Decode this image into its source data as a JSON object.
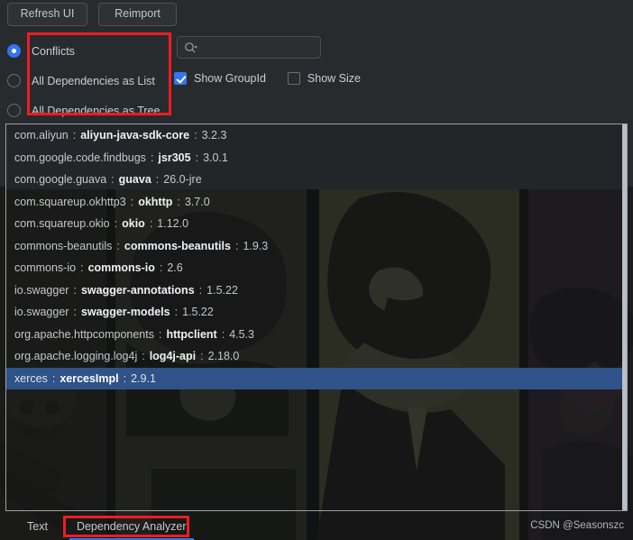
{
  "window": {
    "background_color": "#282b2e",
    "accent_color": "#3574f0",
    "annotation_color": "#ee1c25",
    "selection_color": "#2f5288"
  },
  "toolbar": {
    "refresh_label": "Refresh UI",
    "reimport_label": "Reimport"
  },
  "view_mode": {
    "options": [
      {
        "label": "Conflicts",
        "selected": true
      },
      {
        "label": "All Dependencies as List",
        "selected": false
      },
      {
        "label": "All Dependencies as Tree",
        "selected": false
      }
    ]
  },
  "search": {
    "icon": "search-icon",
    "value": "",
    "placeholder": ""
  },
  "options": {
    "show_groupid": {
      "label": "Show GroupId",
      "checked": true
    },
    "show_size": {
      "label": "Show Size",
      "checked": false
    }
  },
  "dependency_list": {
    "rows": [
      {
        "group": "com.aliyun",
        "artifact": "aliyun-java-sdk-core",
        "version": "3.2.3",
        "selected": false
      },
      {
        "group": "com.google.code.findbugs",
        "artifact": "jsr305",
        "version": "3.0.1",
        "selected": false
      },
      {
        "group": "com.google.guava",
        "artifact": "guava",
        "version": "26.0-jre",
        "selected": false
      },
      {
        "group": "com.squareup.okhttp3",
        "artifact": "okhttp",
        "version": "3.7.0",
        "selected": false
      },
      {
        "group": "com.squareup.okio",
        "artifact": "okio",
        "version": "1.12.0",
        "selected": false
      },
      {
        "group": "commons-beanutils",
        "artifact": "commons-beanutils",
        "version": "1.9.3",
        "selected": false
      },
      {
        "group": "commons-io",
        "artifact": "commons-io",
        "version": "2.6",
        "selected": false
      },
      {
        "group": "io.swagger",
        "artifact": "swagger-annotations",
        "version": "1.5.22",
        "selected": false
      },
      {
        "group": "io.swagger",
        "artifact": "swagger-models",
        "version": "1.5.22",
        "selected": false
      },
      {
        "group": "org.apache.httpcomponents",
        "artifact": "httpclient",
        "version": "4.5.3",
        "selected": false
      },
      {
        "group": "org.apache.logging.log4j",
        "artifact": "log4j-api",
        "version": "2.18.0",
        "selected": false
      },
      {
        "group": "xerces",
        "artifact": "xercesImpl",
        "version": "2.9.1",
        "selected": true
      }
    ],
    "separator": ":"
  },
  "tabs": [
    {
      "label": "Text",
      "active": false
    },
    {
      "label": "Dependency Analyzer",
      "active": true
    }
  ],
  "watermark": "CSDN @Seasonszc"
}
